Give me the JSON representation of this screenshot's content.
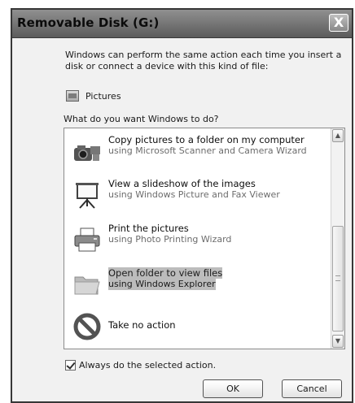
{
  "window": {
    "title": "Removable Disk (G:)",
    "close_label": "X"
  },
  "dialog": {
    "intro": "Windows can perform the same action each time you insert a disk or connect a device with this kind of file:",
    "content_type": "Pictures",
    "question": "What do you want Windows to do?"
  },
  "actions": [
    {
      "label": "Copy pictures to a folder on my computer",
      "desc": "using Microsoft Scanner and Camera Wizard",
      "icon": "camera-icon",
      "selected": false
    },
    {
      "label": "View a slideshow of the images",
      "desc": "using Windows Picture and Fax Viewer",
      "icon": "slideshow-icon",
      "selected": false
    },
    {
      "label": "Print the pictures",
      "desc": "using Photo Printing Wizard",
      "icon": "printer-icon",
      "selected": false
    },
    {
      "label": "Open folder to view files",
      "desc": "using Windows Explorer",
      "icon": "folder-icon",
      "selected": true
    },
    {
      "label": "Take no action",
      "desc": "",
      "icon": "no-action-icon",
      "selected": false
    }
  ],
  "always_checkbox": {
    "label": "Always do the selected action.",
    "checked": true
  },
  "buttons": {
    "ok": "OK",
    "cancel": "Cancel"
  }
}
